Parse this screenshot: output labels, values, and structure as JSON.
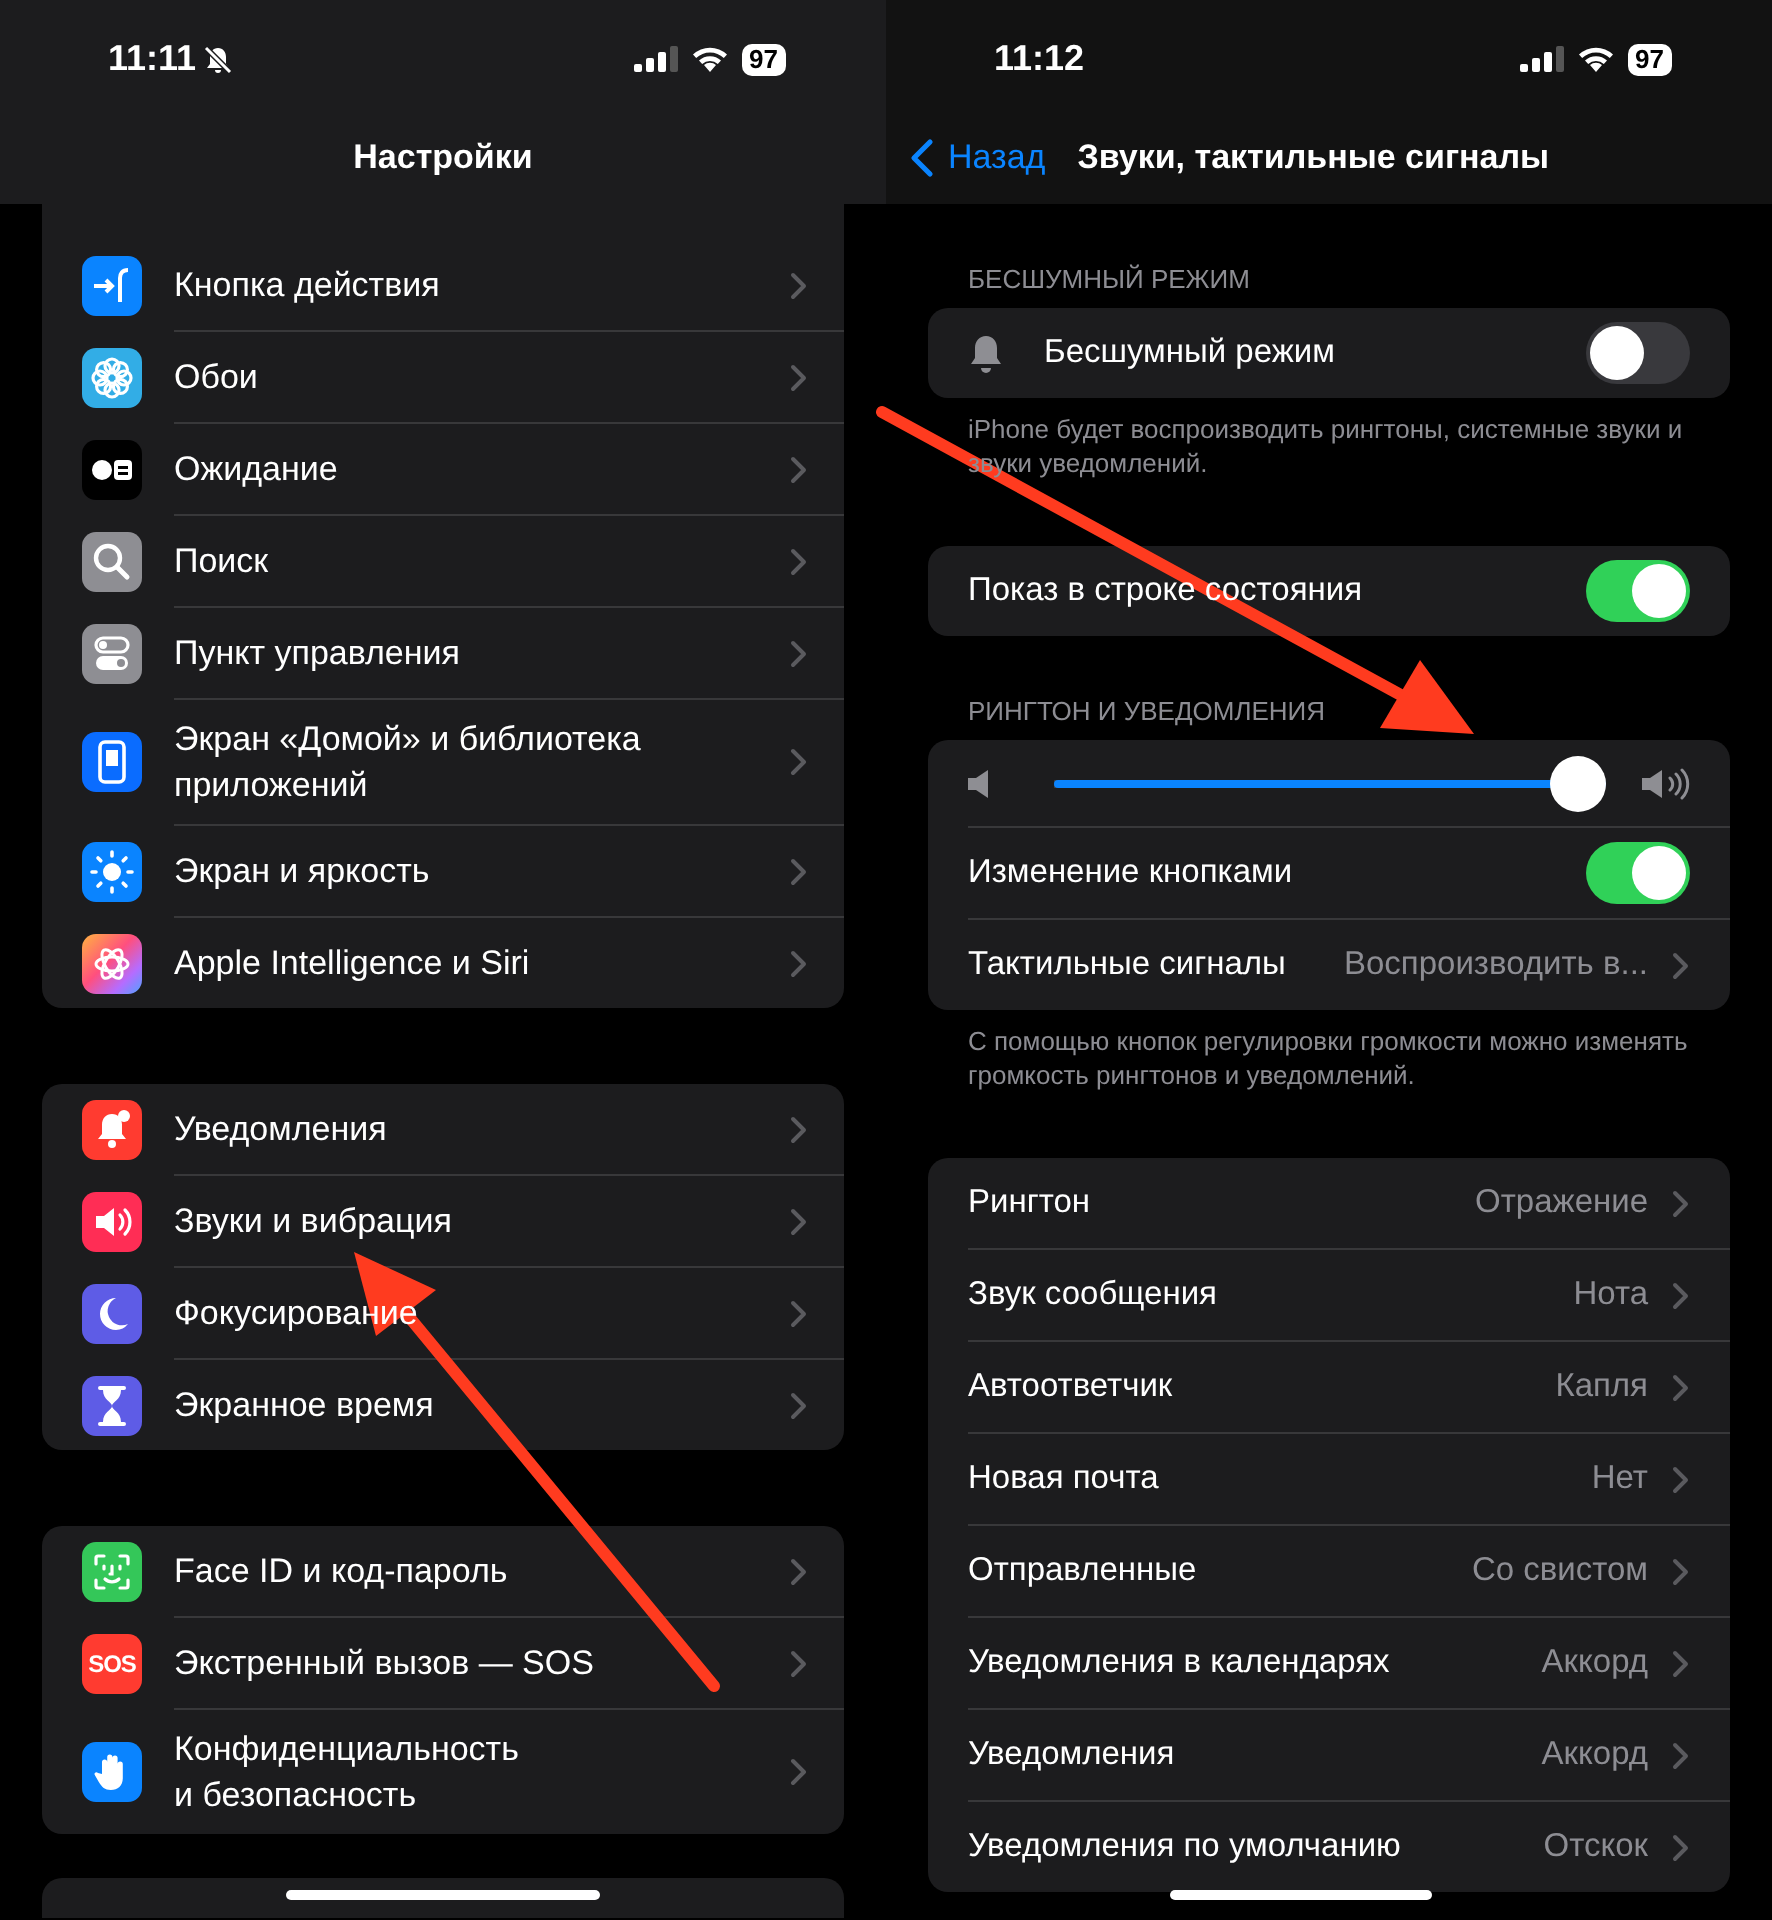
{
  "left": {
    "status_bar": {
      "time": "11:11",
      "silent": true,
      "battery": "97"
    },
    "title": "Настройки",
    "groups": [
      {
        "items": [
          {
            "label": "Кнопка действия"
          },
          {
            "label": "Обои"
          },
          {
            "label": "Ожидание"
          },
          {
            "label": "Поиск"
          },
          {
            "label": "Пункт управления"
          },
          {
            "label": "Экран «Домой» и библиотека\nприложений"
          },
          {
            "label": "Экран и яркость"
          },
          {
            "label": "Apple Intelligence и Siri"
          }
        ]
      },
      {
        "items": [
          {
            "label": "Уведомления"
          },
          {
            "label": "Звуки и вибрация"
          },
          {
            "label": "Фокусирование"
          },
          {
            "label": "Экранное время"
          }
        ]
      },
      {
        "items": [
          {
            "label": "Face ID и код-пароль"
          },
          {
            "icon_text": "SOS",
            "label": "Экстренный вызов — SOS"
          },
          {
            "label": "Конфиденциальность\nи безопасность"
          }
        ]
      }
    ]
  },
  "right": {
    "status_bar": {
      "time": "11:12",
      "battery": "97"
    },
    "back": "Назад",
    "title": "Звуки, тактильные сигналы",
    "sections": [
      {
        "header": "БЕСШУМНЫЙ РЕЖИМ",
        "rows": [
          {
            "kind": "toggle",
            "label": "Бесшумный режим",
            "on": false
          }
        ],
        "footer": "iPhone будет воспроизводить рингтоны, системные звуки и звуки уведомлений."
      },
      {
        "rows": [
          {
            "kind": "toggle",
            "label": "Показ в строке состояния",
            "on": true
          }
        ]
      },
      {
        "header": "РИНГТОН И УВЕДОМЛЕНИЯ",
        "rows": [
          {
            "kind": "slider",
            "level": 1
          },
          {
            "kind": "toggle",
            "label": "Изменение кнопками",
            "on": true
          },
          {
            "kind": "link",
            "label": "Тактильные сигналы",
            "value": "Воспроизводить в..."
          }
        ],
        "footer": "С помощью кнопок регулировки громкости можно изменять громкость рингтонов и уведомлений."
      },
      {
        "rows": [
          {
            "kind": "link",
            "label": "Рингтон",
            "value": "Отражение"
          },
          {
            "kind": "link",
            "label": "Звук сообщения",
            "value": "Нота"
          },
          {
            "kind": "link",
            "label": "Автоответчик",
            "value": "Капля"
          },
          {
            "kind": "link",
            "label": "Новая почта",
            "value": "Нет"
          },
          {
            "kind": "link",
            "label": "Отправленные",
            "value": "Со свистом"
          },
          {
            "kind": "link",
            "label": "Уведомления в календарях",
            "value": "Аккорд"
          },
          {
            "kind": "link",
            "label": "Уведомления",
            "value": "Аккорд"
          },
          {
            "kind": "link",
            "label": "Уведомления по умолчанию",
            "value": "Отскок"
          }
        ]
      }
    ]
  }
}
